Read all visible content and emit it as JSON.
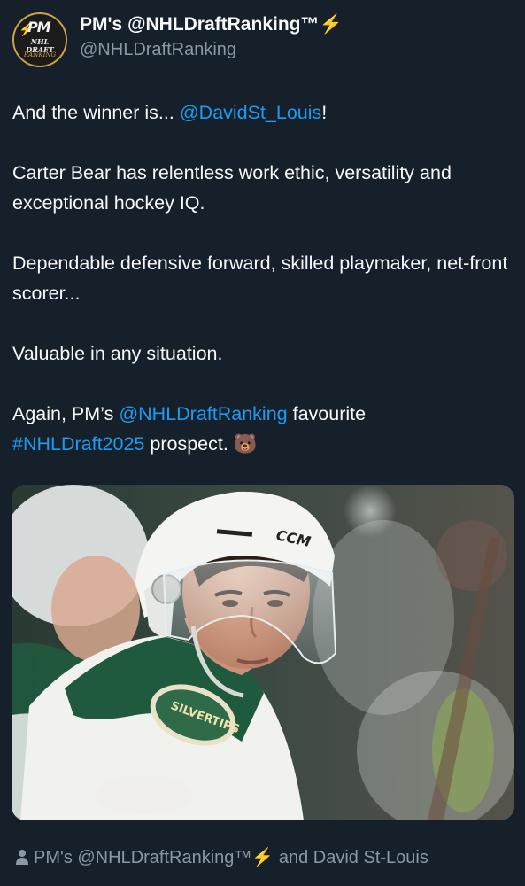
{
  "author": {
    "display_name": "PM's @NHLDraftRanking™",
    "name_emoji": "⚡",
    "handle": "@NHLDraftRanking",
    "avatar_text_main": "PM",
    "avatar_text_sub": "NHL DRAFT",
    "avatar_text_sub2": "RANKING"
  },
  "tweet": {
    "p1_prefix": "And the winner is... ",
    "p1_mention": "@DavidSt_Louis",
    "p1_suffix": "!",
    "p2": "Carter Bear has relentless work ethic, versatility and exceptional hockey IQ.",
    "p3": "Dependable defensive forward, skilled playmaker, net-front scorer...",
    "p4": "Valuable in any situation.",
    "p5_prefix": "Again, PM’s ",
    "p5_mention": "@NHLDraftRanking",
    "p5_mid": " favourite",
    "p5_hashtag": "#NHLDraft2025",
    "p5_suffix": " prospect. ",
    "p5_emoji": "🐻"
  },
  "media": {
    "helmet_brand": "CCM",
    "jersey_logo_text": "SILVERTIPS"
  },
  "tagged": {
    "user1": "PM's @NHLDraftRanking™",
    "user1_emoji": "⚡",
    "connector": " and ",
    "user2": "David St-Louis"
  },
  "colors": {
    "background": "#15202b",
    "link": "#1d9bf0",
    "secondary_text": "#8b98a5"
  }
}
